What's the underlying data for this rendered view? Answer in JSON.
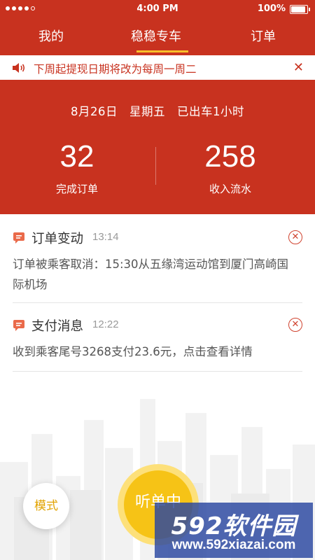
{
  "status_bar": {
    "time": "4:00 PM",
    "battery": "100%"
  },
  "tabs": [
    {
      "label": "我的"
    },
    {
      "label": "稳稳专车"
    },
    {
      "label": "订单"
    }
  ],
  "notice": {
    "text": "下周起提现日期将改为每周一周二",
    "close": "✕"
  },
  "summary": {
    "date_line": "8月26日　星期五　已出车1小时",
    "orders_value": "32",
    "orders_label": "完成订单",
    "income_value": "258",
    "income_label": "收入流水"
  },
  "messages": [
    {
      "title": "订单变动",
      "time": "13:14",
      "body": "订单被乘客取消：15:30从五缘湾运动馆到厦门高崎国际机场",
      "close": "✕"
    },
    {
      "title": "支付消息",
      "time": "12:22",
      "body": "收到乘客尾号3268支付23.6元，点击查看详情",
      "close": "✕"
    }
  ],
  "buttons": {
    "mode": "模式",
    "listen": "听单中"
  },
  "watermark": {
    "brand": "592软件园",
    "url": "www.592xiazai.com"
  },
  "colors": {
    "primary_red": "#c8321f",
    "accent_yellow": "#f6c316",
    "tab_underline": "#f7c02a"
  }
}
